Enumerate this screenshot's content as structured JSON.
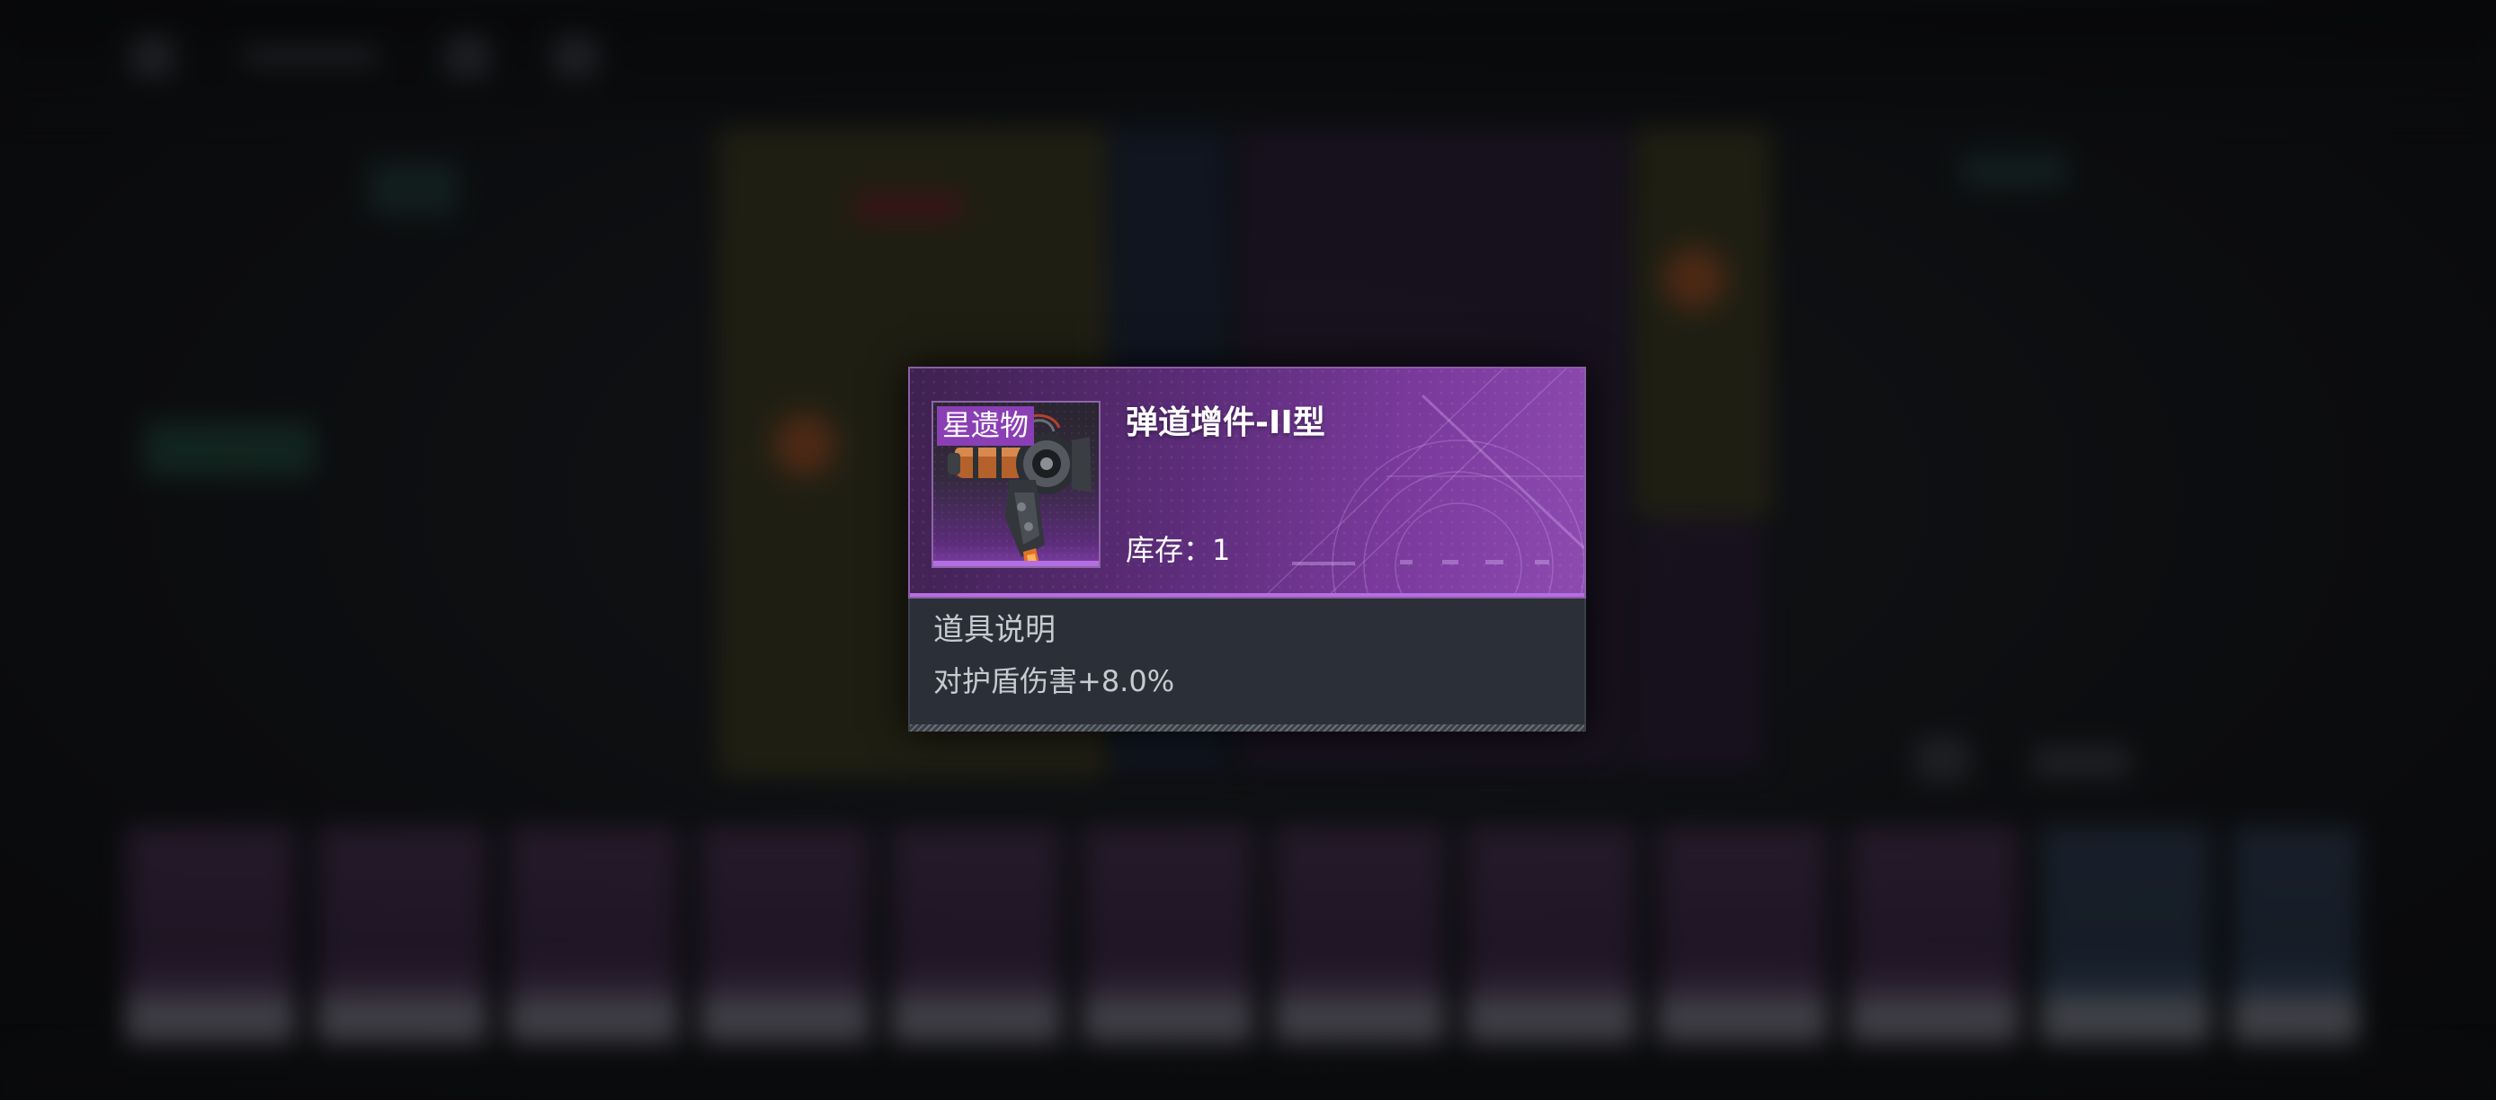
{
  "popup": {
    "rarity_tag": "星遗物",
    "item_name": "弹道增件-II型",
    "stock_label": "库存：",
    "stock_value": "1",
    "description_title": "道具说明",
    "description_text": "对护盾伤害+8.0%"
  },
  "icons": {
    "item_art": "ballistic-augment-module-icon"
  },
  "colors": {
    "rarity_purple": "#8a3fb5",
    "header_gradient_end": "#8d4bb0",
    "body_bg": "#2b2f37"
  }
}
